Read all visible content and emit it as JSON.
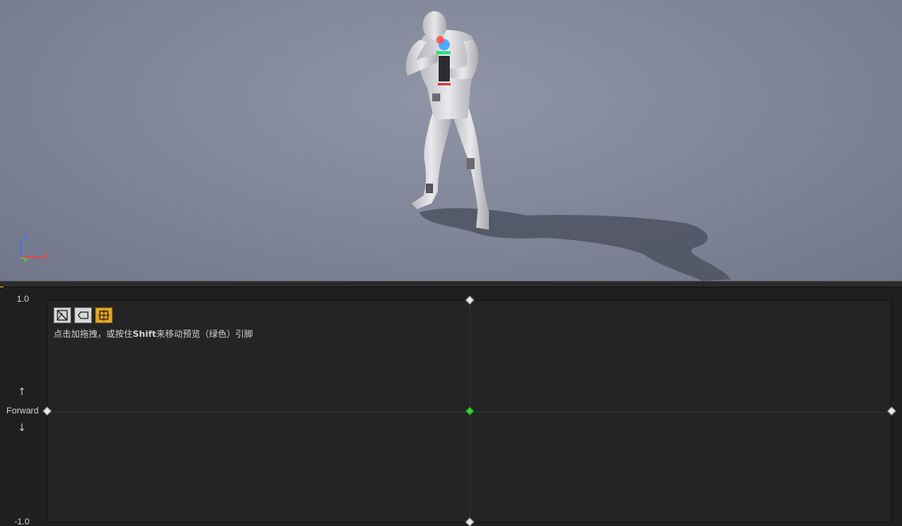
{
  "graph": {
    "axis_max": "1.0",
    "axis_min": "-1.0",
    "vertical_axis_name": "Forward",
    "up_arrow": "↑",
    "down_arrow": "↓"
  },
  "toolbar": {
    "tools": [
      {
        "icon": "triangulation-icon",
        "active": false
      },
      {
        "icon": "tag-icon",
        "active": false
      },
      {
        "icon": "fit-view-icon",
        "active": true
      }
    ]
  },
  "hint": {
    "prefix": "点击加拖拽，或按住",
    "key": "Shift",
    "suffix": "来移动预览（绿色）引脚"
  },
  "viewport": {
    "axis_z": "Z",
    "axis_x": "X",
    "axis_y": "Y"
  },
  "colors": {
    "accent": "#e0a52a",
    "preview_pin": "#33d633",
    "viewport_bg": "#8288a0",
    "panel_bg": "#242424"
  }
}
